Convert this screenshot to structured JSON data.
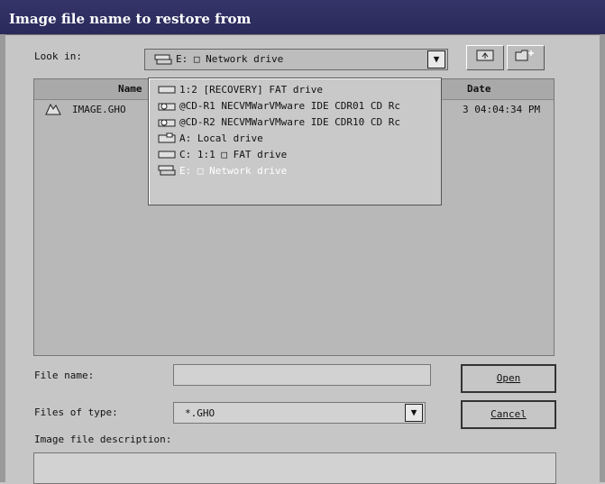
{
  "window": {
    "title": "Image file name to restore from"
  },
  "lookin": {
    "label": "Look in:",
    "value": "E: □ Network drive"
  },
  "list": {
    "headers": {
      "name": "Name",
      "date": "Date"
    },
    "files": [
      {
        "name": "IMAGE.GHO",
        "date": "3 04:04:34 PM"
      }
    ]
  },
  "dropdown": {
    "items": [
      {
        "label": "1:2 [RECOVERY] FAT drive",
        "icon": "drive-icon",
        "selected": false
      },
      {
        "label": "@CD-R1 NECVMWarVMware IDE CDR01 CD Rc",
        "icon": "cd-icon",
        "selected": false
      },
      {
        "label": "@CD-R2 NECVMWarVMware IDE CDR10 CD Rc",
        "icon": "cd-icon",
        "selected": false
      },
      {
        "label": "A: Local drive",
        "icon": "floppy-icon",
        "selected": false
      },
      {
        "label": "C: 1:1 □ FAT drive",
        "icon": "drive-icon",
        "selected": false
      },
      {
        "label": "E: □ Network drive",
        "icon": "network-drive-icon",
        "selected": true
      }
    ]
  },
  "filename": {
    "label": "File name:",
    "value": ""
  },
  "filetype": {
    "label": "Files of type:",
    "value": "*.GHO"
  },
  "description": {
    "label": "Image file description:",
    "value": ""
  },
  "buttons": {
    "open": "Open",
    "cancel": "Cancel"
  },
  "colors": {
    "titlebar": "#2a2a5a",
    "selected_text": "#ffffff"
  }
}
